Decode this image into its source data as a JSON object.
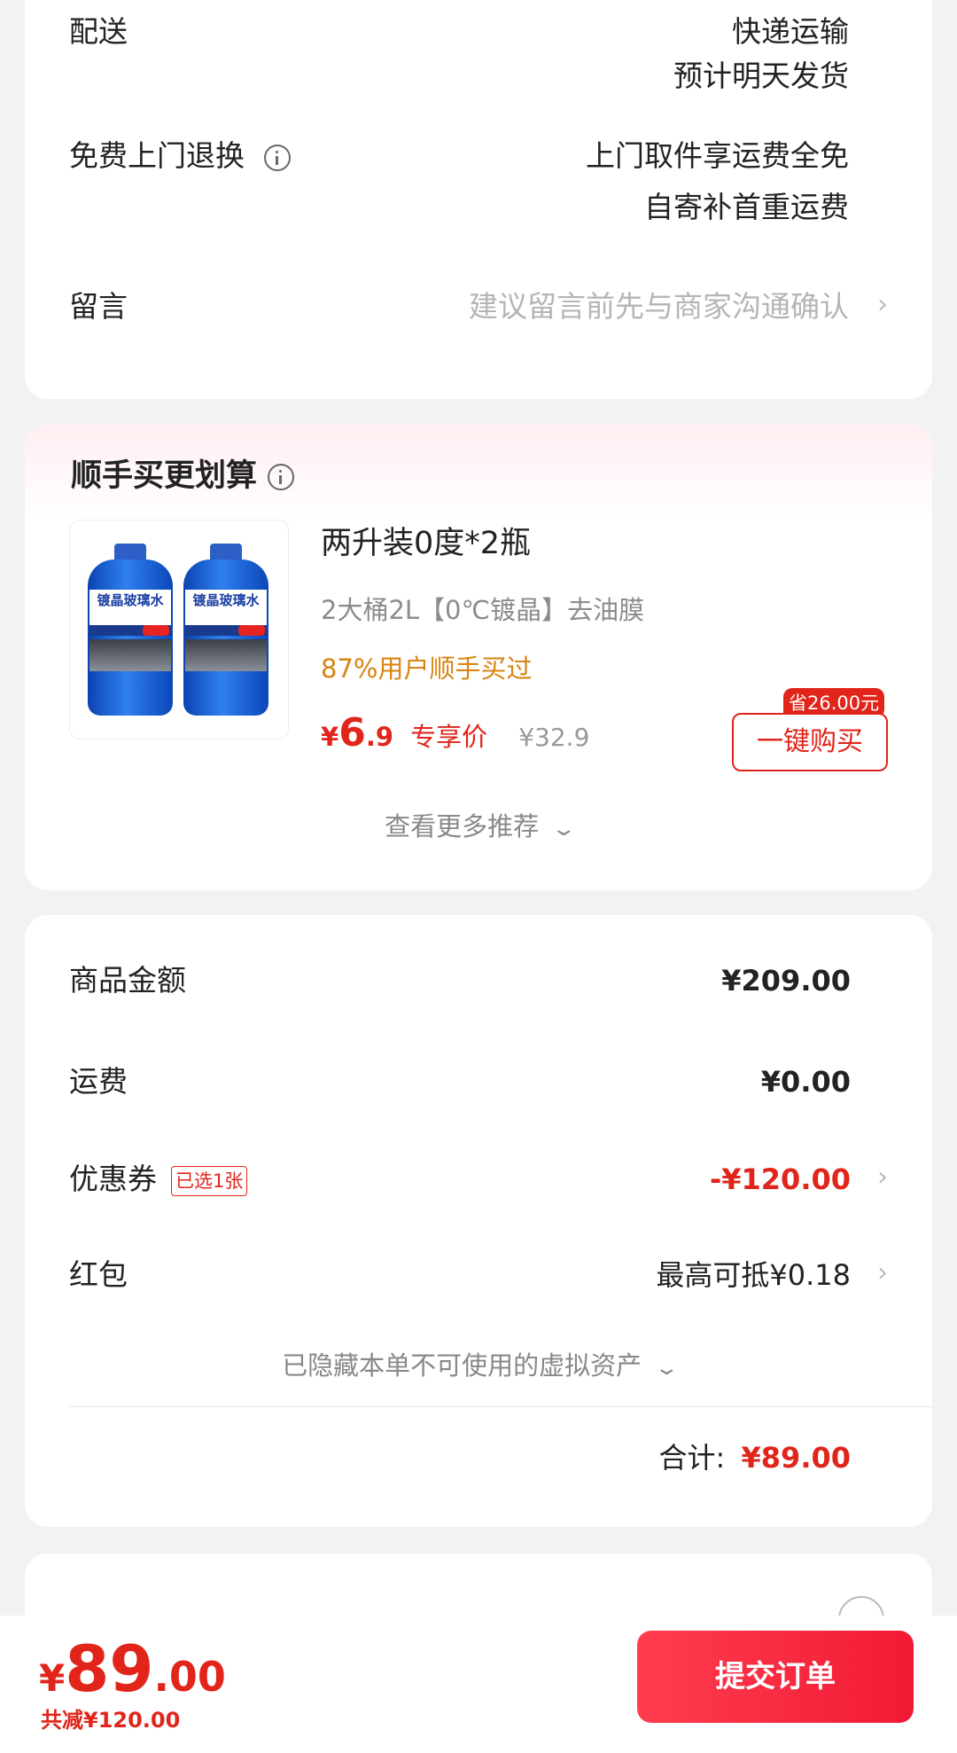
{
  "shipping": {
    "delivery_label": "配送",
    "delivery_method": "快递运输",
    "delivery_eta": "预计明天发货",
    "free_return_label": "免费上门退换",
    "free_return_line1": "上门取件享运费全免",
    "free_return_line2": "自寄补首重运费",
    "message_label": "留言",
    "message_placeholder": "建议留言前先与商家沟通确认",
    "chevron": "›"
  },
  "bundle": {
    "title": "顺手买更划算",
    "product_title": "两升装0度*2瓶",
    "product_desc": "2大桶2L【0℃镀晶】去油膜",
    "bought_ratio": "87%用户顺手买过",
    "price_symbol": "¥",
    "price_int": "6",
    "price_dec": ".9",
    "price_tag": "专享价",
    "original_price": "¥32.9",
    "save_tag": "省26.00元",
    "buy_button": "一键购买",
    "bottle_label": "镀晶玻璃水",
    "more_label": "查看更多推荐",
    "more_icon": "chevron-down"
  },
  "summary": {
    "goods_label": "商品金额",
    "goods_value": "¥209.00",
    "freight_label": "运费",
    "freight_value": "¥0.00",
    "coupon_label": "优惠券",
    "coupon_badge": "已选1张",
    "coupon_value": "-¥120.00",
    "redpacket_label": "红包",
    "redpacket_value": "最高可抵¥0.18",
    "hidden_assets": "已隐藏本单不可使用的虚拟资产",
    "total_label": "合计:",
    "total_value": "¥89.00"
  },
  "bottom": {
    "price_symbol": "¥",
    "price_int": "89",
    "price_dec": ".00",
    "discount": "共减¥120.00",
    "submit": "提交订单"
  },
  "colors": {
    "accent_red": "#e1251b",
    "submit_red": "#f11a35",
    "orange_text": "#d98412"
  }
}
